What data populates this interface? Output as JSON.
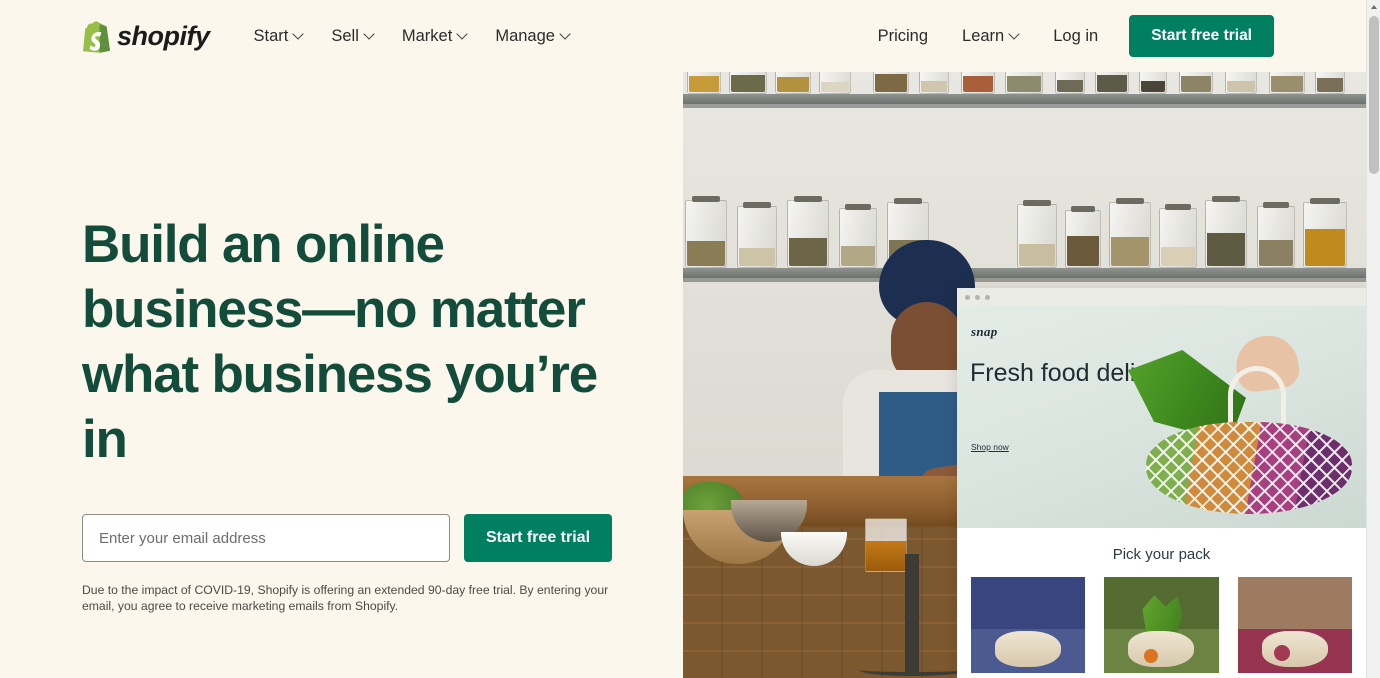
{
  "header": {
    "logo": {
      "icon": "shopify-bag-icon",
      "wordmark": "shopify"
    },
    "nav_left": [
      {
        "label": "Start",
        "caret": true
      },
      {
        "label": "Sell",
        "caret": true
      },
      {
        "label": "Market",
        "caret": true
      },
      {
        "label": "Manage",
        "caret": true
      }
    ],
    "nav_right": [
      {
        "label": "Pricing",
        "caret": false
      },
      {
        "label": "Learn",
        "caret": true
      },
      {
        "label": "Log in",
        "caret": false
      }
    ],
    "cta_label": "Start free trial"
  },
  "hero": {
    "headline": "Build an online business—no matter what business you’re in",
    "email_placeholder": "Enter your email address",
    "email_value": "",
    "submit_label": "Start free trial",
    "disclaimer": "Due to the impact of COVID-19, Shopify is offering an extended 90-day free trial. By entering your email, you agree to receive marketing emails from Shopify."
  },
  "mockup": {
    "brand": "snap",
    "title": "Fresh food delivered",
    "link_label": "Shop now",
    "section_title": "Pick your pack",
    "cards": [
      {
        "name": "onion-pack",
        "top_color": "#39457e",
        "floor_color": "#4c5a92",
        "item_color": "#8e2464"
      },
      {
        "name": "greens-pack",
        "top_color": "#546b31",
        "floor_color": "#6b8343",
        "item_color": "#d9761f"
      },
      {
        "name": "roots-pack",
        "top_color": "#9c7b61",
        "floor_color": "#963350",
        "item_color": "#a23a52"
      }
    ]
  },
  "colors": {
    "page_background": "#fbf7ec",
    "brand_green": "#008060",
    "headline_green": "#134c3b",
    "logo_green": "#95bf47"
  },
  "scrollbar": {
    "position": "right",
    "thumb_visible": true
  }
}
